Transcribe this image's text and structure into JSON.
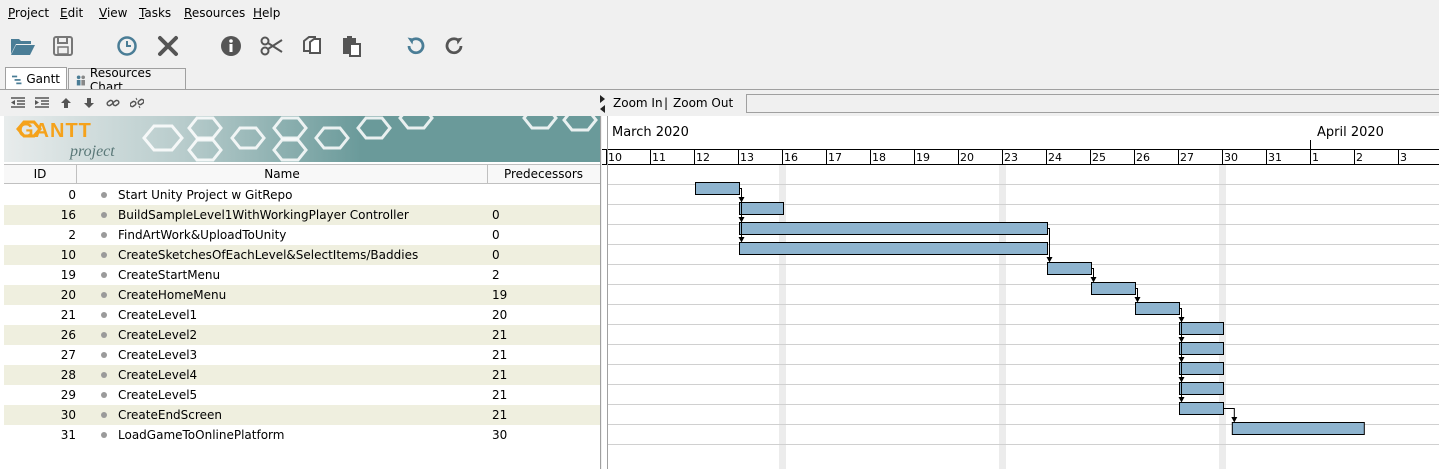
{
  "menubar": {
    "items": [
      {
        "key": "P",
        "rest": "roject"
      },
      {
        "key": "E",
        "rest": "dit"
      },
      {
        "key": "V",
        "rest": "iew"
      },
      {
        "key": "T",
        "rest": "asks"
      },
      {
        "key": "R",
        "rest": "esources"
      },
      {
        "key": "H",
        "rest": "elp"
      }
    ]
  },
  "toolbar": {
    "icons": [
      "open-folder-icon",
      "save-icon",
      "history-icon",
      "delete-icon",
      "info-icon",
      "cut-icon",
      "copy-icon",
      "paste-icon",
      "undo-icon",
      "redo-icon"
    ]
  },
  "tabs": [
    {
      "label": "Gantt",
      "active": true
    },
    {
      "label": "Resources Chart",
      "active": false
    }
  ],
  "logo": {
    "line1": "GANTT",
    "line2": "project"
  },
  "table": {
    "columns": {
      "id": "ID",
      "name": "Name",
      "predecessors": "Predecessors"
    },
    "rows": [
      {
        "id": "0",
        "name": "Start Unity Project w GitRepo",
        "pred": ""
      },
      {
        "id": "16",
        "name": "BuildSampleLevel1WithWorkingPlayer Controller",
        "pred": "0"
      },
      {
        "id": "2",
        "name": "FindArtWork&UploadToUnity",
        "pred": "0"
      },
      {
        "id": "10",
        "name": "CreateSketchesOfEachLevel&SelectItems/Baddies",
        "pred": "0"
      },
      {
        "id": "19",
        "name": "CreateStartMenu",
        "pred": "2"
      },
      {
        "id": "20",
        "name": "CreateHomeMenu",
        "pred": "19"
      },
      {
        "id": "21",
        "name": "CreateLevel1",
        "pred": "20"
      },
      {
        "id": "26",
        "name": "CreateLevel2",
        "pred": "21"
      },
      {
        "id": "27",
        "name": "CreateLevel3",
        "pred": "21"
      },
      {
        "id": "28",
        "name": "CreateLevel4",
        "pred": "21"
      },
      {
        "id": "29",
        "name": "CreateLevel5",
        "pred": "21"
      },
      {
        "id": "30",
        "name": "CreateEndScreen",
        "pred": "21"
      },
      {
        "id": "31",
        "name": "LoadGameToOnlinePlatform",
        "pred": "30"
      }
    ]
  },
  "chart": {
    "zoom_in": "Zoom In",
    "separator": "|",
    "zoom_out": "Zoom Out",
    "months": [
      "March 2020",
      "April 2020"
    ],
    "days": [
      "10",
      "11",
      "12",
      "13",
      "16",
      "17",
      "18",
      "19",
      "20",
      "23",
      "24",
      "25",
      "26",
      "27",
      "30",
      "31",
      "1",
      "2",
      "3"
    ],
    "bar_color": "#8eb4cf",
    "tasks": [
      {
        "start": 2,
        "end": 3
      },
      {
        "start": 3,
        "end": 4
      },
      {
        "start": 3,
        "end": 10
      },
      {
        "start": 3,
        "end": 10
      },
      {
        "start": 10,
        "end": 11
      },
      {
        "start": 11,
        "end": 12
      },
      {
        "start": 12,
        "end": 13
      },
      {
        "start": 13,
        "end": 14
      },
      {
        "start": 13,
        "end": 14
      },
      {
        "start": 13,
        "end": 14
      },
      {
        "start": 13,
        "end": 14
      },
      {
        "start": 13,
        "end": 14
      },
      {
        "start": 14.2,
        "end": 17.2
      }
    ]
  }
}
